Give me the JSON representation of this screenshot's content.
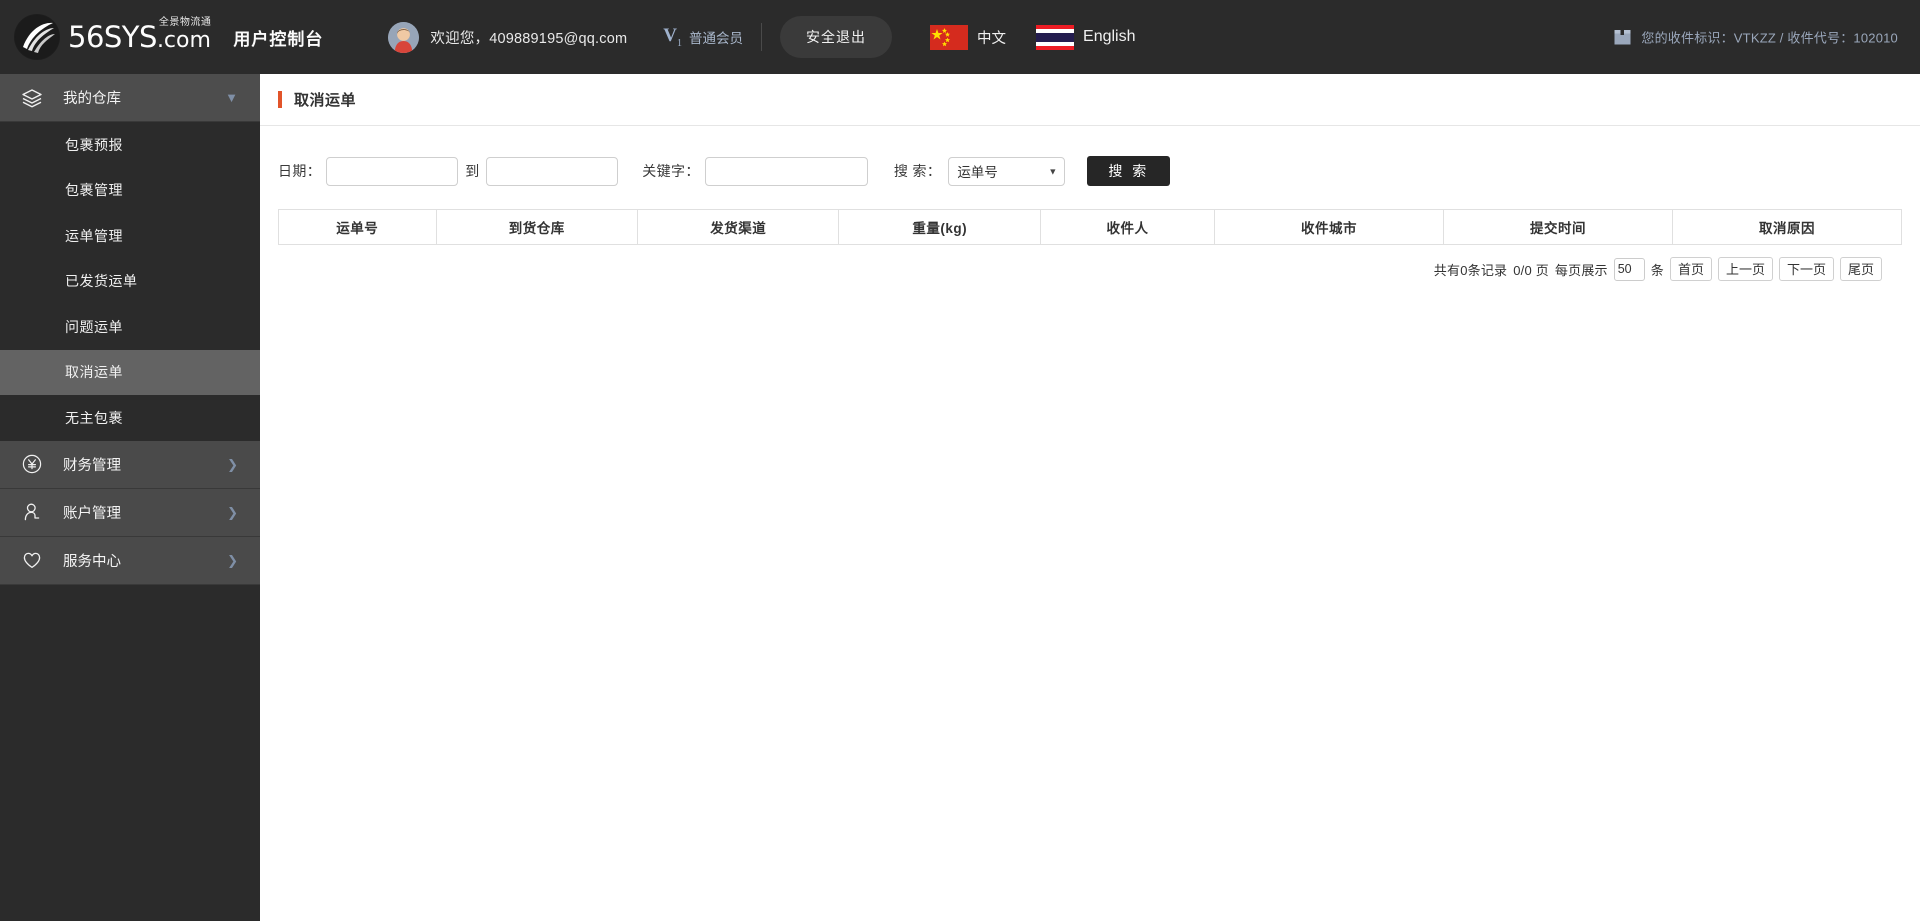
{
  "header": {
    "logo_main": "56SYS",
    "logo_dotcom": ".com",
    "logo_slogan": "全景物流通",
    "console_title": "用户控制台",
    "avatar_icon": "user-avatar",
    "welcome": "欢迎您，409889195@qq.com",
    "vip_mark": "V",
    "vip_mark_sub": "1",
    "vip_label": "普通会员",
    "logout_label": "安全退出",
    "lang_cn": {
      "flag": "china-flag",
      "label": "中文"
    },
    "lang_en": {
      "flag": "thailand-flag",
      "label": "English"
    },
    "recv_icon": "box-icon",
    "recv_text": "您的收件标识：VTKZZ / 收件代号：102010"
  },
  "sidebar": {
    "groups": [
      {
        "label": "我的仓库",
        "icon": "layers-icon",
        "chevron": "chevron-down-icon",
        "expanded": true,
        "items": [
          {
            "label": "包裹预报",
            "active": false
          },
          {
            "label": "包裹管理",
            "active": false
          },
          {
            "label": "运单管理",
            "active": false
          },
          {
            "label": "已发货运单",
            "active": false
          },
          {
            "label": "问题运单",
            "active": false
          },
          {
            "label": "取消运单",
            "active": true
          },
          {
            "label": "无主包裹",
            "active": false
          }
        ]
      },
      {
        "label": "财务管理",
        "icon": "yen-circle-icon",
        "chevron": "chevron-right-icon",
        "expanded": false,
        "items": []
      },
      {
        "label": "账户管理",
        "icon": "person-icon",
        "chevron": "chevron-right-icon",
        "expanded": false,
        "items": []
      },
      {
        "label": "服务中心",
        "icon": "shield-icon",
        "chevron": "chevron-right-icon",
        "expanded": false,
        "items": []
      }
    ]
  },
  "main": {
    "page_title": "取消运单",
    "filters": {
      "date_label": "日期：",
      "date_from_value": "",
      "date_from_placeholder": "",
      "between_label": "到",
      "date_to_value": "",
      "date_to_placeholder": "",
      "keyword_label": "关键字：",
      "keyword_value": "",
      "keyword_placeholder": "",
      "search_by_label": "搜 索：",
      "search_by_selected": "运单号",
      "search_by_options": [
        "运单号"
      ],
      "search_button": "搜 索"
    },
    "table": {
      "columns": [
        "运单号",
        "到货仓库",
        "发货渠道",
        "重量(kg)",
        "收件人",
        "收件城市",
        "提交时间",
        "取消原因"
      ],
      "rows": []
    },
    "pager": {
      "total_text": "共有0条记录",
      "page_text": "0/0 页",
      "per_page_label": "每页展示",
      "per_page_value": "50",
      "per_page_unit": "条",
      "first": "首页",
      "prev": "上一页",
      "next": "下一页",
      "last": "尾页"
    }
  },
  "colors": {
    "header_bg": "#2b2b2b",
    "sidebar_bg": "#2b2b2b",
    "sidebar_active": "#636363",
    "accent": "#e2542a",
    "button_dark": "#262626"
  }
}
